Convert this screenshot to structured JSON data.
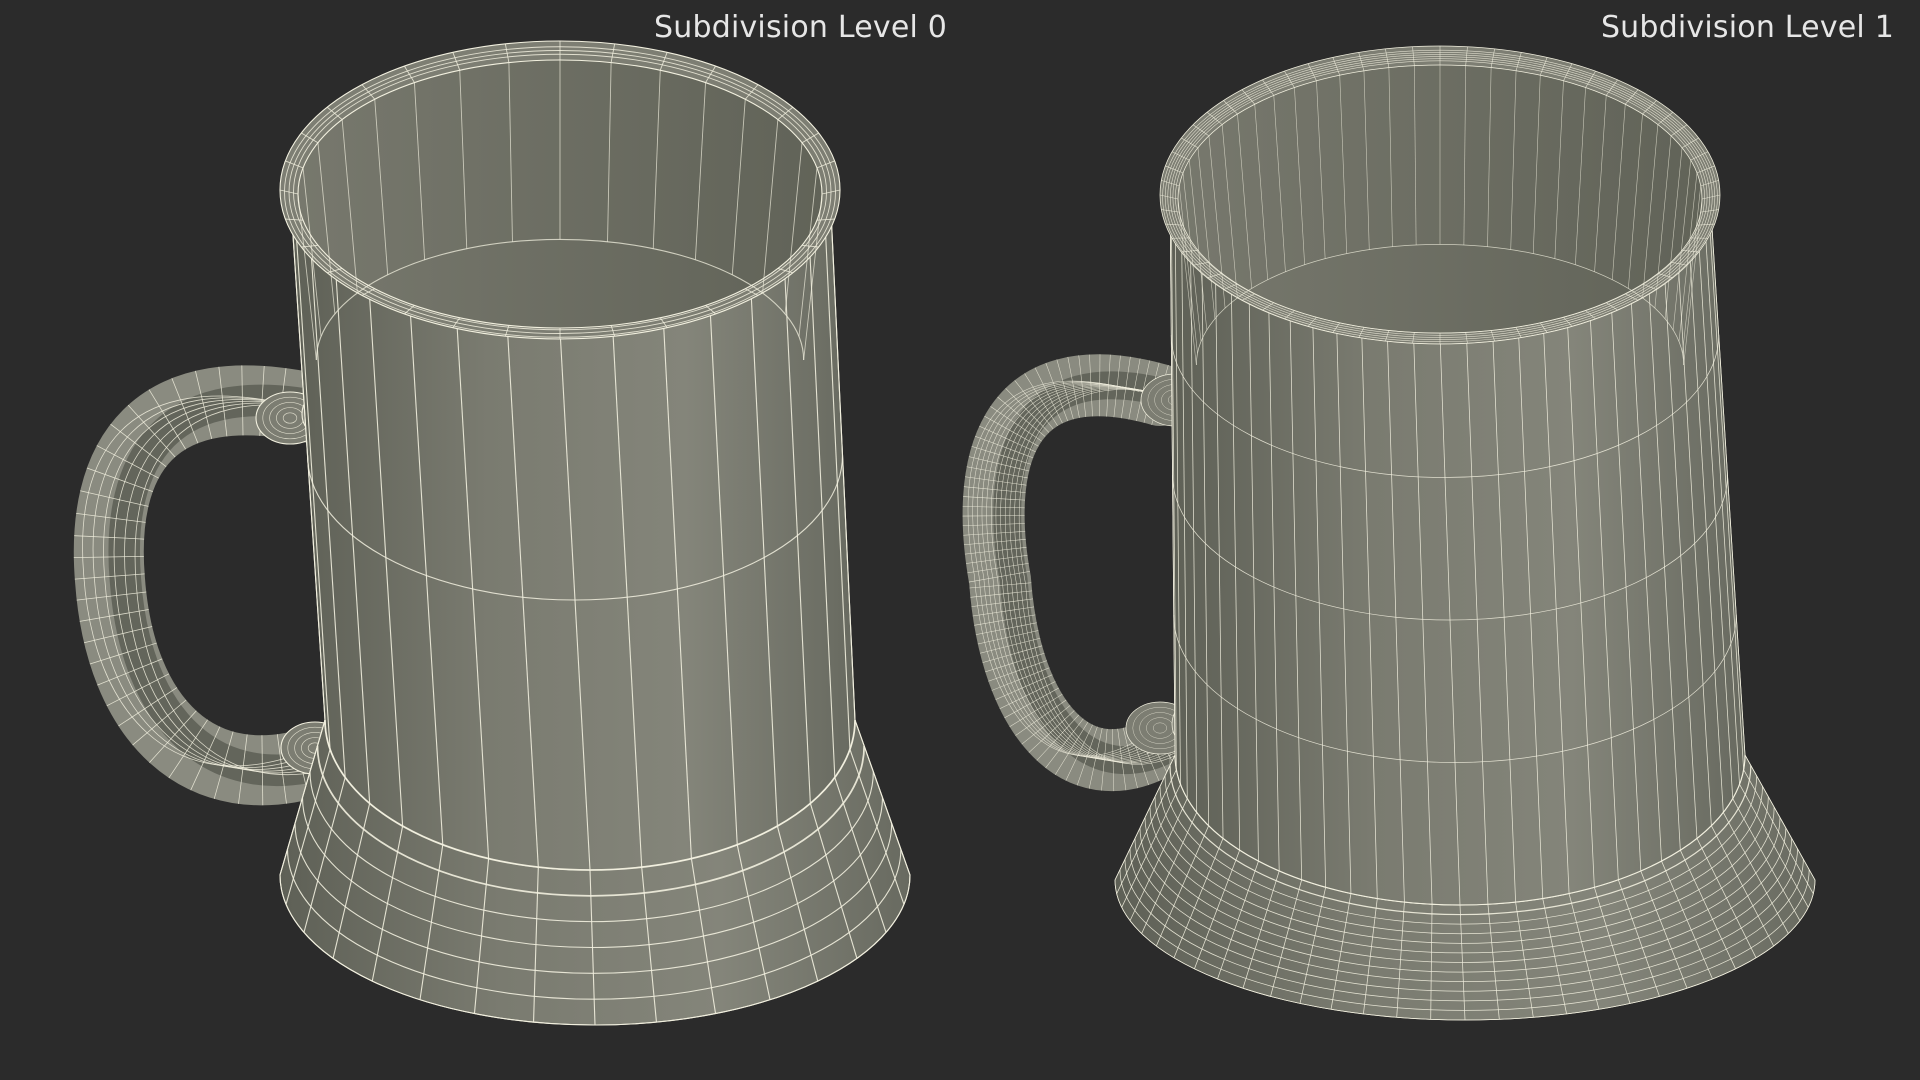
{
  "labels": {
    "left": "Subdivision Level 0",
    "right": "Subdivision Level 1"
  },
  "colors": {
    "background": "#2b2b2b",
    "mug_body": "#797a6e",
    "mug_shadow": "#55574d",
    "mug_inner": "#6e6f64",
    "wire": "#f2f0df",
    "caption": "#e6e6e6"
  }
}
